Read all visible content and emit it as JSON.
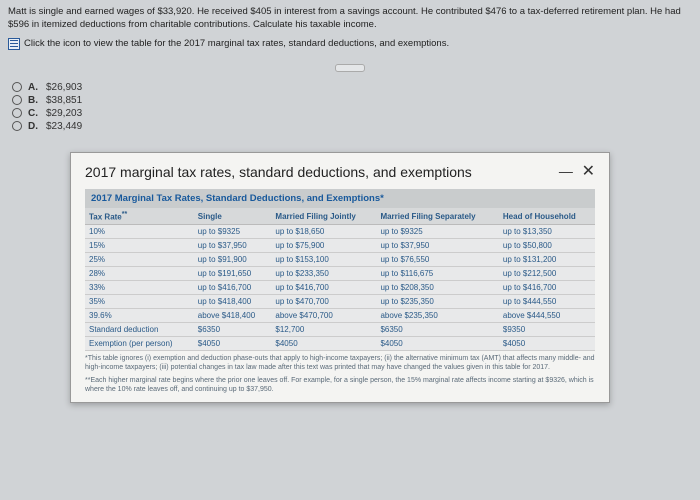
{
  "problem": {
    "text1": "Matt is single and earned wages of $33,920. He received $405 in interest from a savings account. He contributed $476 to a tax-deferred retirement plan. He had $596 in itemized deductions from charitable contributions. Calculate his taxable income.",
    "link_text": "Click the icon to view the table for the 2017 marginal tax rates, standard deductions, and exemptions."
  },
  "options": {
    "a": {
      "label": "A.",
      "value": "$26,903"
    },
    "b": {
      "label": "B.",
      "value": "$38,851"
    },
    "c": {
      "label": "C.",
      "value": "$29,203"
    },
    "d": {
      "label": "D.",
      "value": "$23,449"
    }
  },
  "modal": {
    "title": "2017 marginal tax rates, standard deductions, and exemptions",
    "subhead": "2017 Marginal Tax Rates, Standard Deductions, and Exemptions*",
    "headers": {
      "rate": "Tax Rate",
      "single": "Single",
      "joint": "Married Filing Jointly",
      "sep": "Married Filing Separately",
      "hoh": "Head of Household"
    },
    "rows": [
      {
        "rate": "10%",
        "single": "up to $9325",
        "joint": "up to $18,650",
        "sep": "up to $9325",
        "hoh": "up to $13,350"
      },
      {
        "rate": "15%",
        "single": "up to $37,950",
        "joint": "up to $75,900",
        "sep": "up to $37,950",
        "hoh": "up to $50,800"
      },
      {
        "rate": "25%",
        "single": "up to $91,900",
        "joint": "up to $153,100",
        "sep": "up to $76,550",
        "hoh": "up to $131,200"
      },
      {
        "rate": "28%",
        "single": "up to $191,650",
        "joint": "up to $233,350",
        "sep": "up to $116,675",
        "hoh": "up to $212,500"
      },
      {
        "rate": "33%",
        "single": "up to $416,700",
        "joint": "up to $416,700",
        "sep": "up to $208,350",
        "hoh": "up to $416,700"
      },
      {
        "rate": "35%",
        "single": "up to $418,400",
        "joint": "up to $470,700",
        "sep": "up to $235,350",
        "hoh": "up to $444,550"
      },
      {
        "rate": "39.6%",
        "single": "above $418,400",
        "joint": "above $470,700",
        "sep": "above $235,350",
        "hoh": "above $444,550"
      },
      {
        "rate": "Standard deduction",
        "single": "$6350",
        "joint": "$12,700",
        "sep": "$6350",
        "hoh": "$9350"
      },
      {
        "rate": "Exemption (per person)",
        "single": "$4050",
        "joint": "$4050",
        "sep": "$4050",
        "hoh": "$4050"
      }
    ],
    "footnote1": "*This table ignores (i) exemption and deduction phase-outs that apply to high-income taxpayers; (ii) the alternative minimum tax (AMT) that affects many middle- and high-income taxpayers; (iii) potential changes in tax law made after this text was printed that may have changed the values given in this table for 2017.",
    "footnote2": "**Each higher marginal rate begins where the prior one leaves off. For example, for a single person, the 15% marginal rate affects income starting at $9326, which is where the 10% rate leaves off, and continuing up to $37,950."
  }
}
